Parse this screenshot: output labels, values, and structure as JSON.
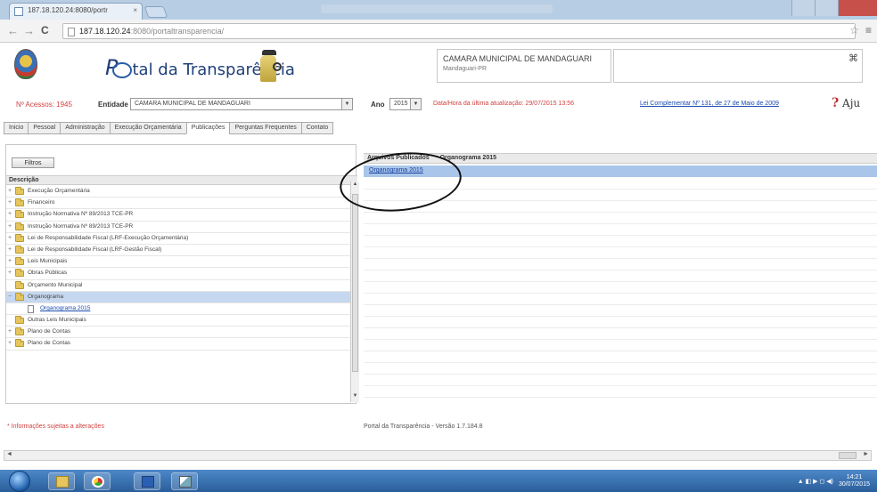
{
  "browser": {
    "tab_title": "187.18.120.24:8080/portr",
    "tab_close": "×",
    "url_host": "187.18.120.24",
    "url_path": ":8080/portaltransparencia/",
    "back": "←",
    "forward": "→",
    "reload": "C",
    "star": "☆",
    "menu": "≡"
  },
  "header": {
    "title_p": "P",
    "title_rest": "tal da Transparência",
    "org_name": "CAMARA MUNICIPAL DE MANDAGUARI",
    "org_city": "Mandaguari-PR",
    "pin": "⌘"
  },
  "filters": {
    "accesses": "Nº Acessos: 1945",
    "entity_label": "Entidade",
    "entity_value": "CAMARA MUNICIPAL DE MANDAGUARI",
    "year_label": "Ano",
    "year_value": "2015",
    "last_update": "Data/Hora da última atualização: 29/07/2015 13:56",
    "law_link": "Lei Complementar Nº 131, de 27 de Maio de 2009",
    "help_label": "Aju",
    "dropdown_glyph": "▼"
  },
  "menu_tabs": [
    {
      "label": "Inicio",
      "active": false
    },
    {
      "label": "Pessoal",
      "active": false
    },
    {
      "label": "Administração",
      "active": false
    },
    {
      "label": "Execução Orçamentária",
      "active": false
    },
    {
      "label": "Publicações",
      "active": true
    },
    {
      "label": "Perguntas Frequentes",
      "active": false
    },
    {
      "label": "Contato",
      "active": false
    }
  ],
  "left_panel": {
    "filter_button": "Filtros",
    "column_header": "Descrição",
    "tree": [
      {
        "label": "Execução Orçamentária",
        "expander": "+",
        "icon": "folder-icon",
        "level": 0,
        "selected": false
      },
      {
        "label": "Financeiro",
        "expander": "+",
        "icon": "folder-icon",
        "level": 0,
        "selected": false
      },
      {
        "label": "Instrução Normativa Nº 89/2013 TCE-PR",
        "expander": "+",
        "icon": "folder-icon",
        "level": 0,
        "selected": false
      },
      {
        "label": "Instrução Normativa Nº 89/2013 TCE-PR",
        "expander": "+",
        "icon": "folder-icon",
        "level": 0,
        "selected": false
      },
      {
        "label": "Lei de Responsabilidade Fiscal (LRF-Execução Orçamentária)",
        "expander": "+",
        "icon": "folder-icon",
        "level": 0,
        "selected": false
      },
      {
        "label": "Lei de Responsabilidade Fiscal (LRF-Gestão Fiscal)",
        "expander": "+",
        "icon": "folder-icon",
        "level": 0,
        "selected": false
      },
      {
        "label": "Leis Municipais",
        "expander": "+",
        "icon": "folder-icon",
        "level": 0,
        "selected": false
      },
      {
        "label": "Obras Públicas",
        "expander": "+",
        "icon": "folder-icon",
        "level": 0,
        "selected": false
      },
      {
        "label": "Orçamento Municipal",
        "expander": "",
        "icon": "folder-icon",
        "level": 0,
        "selected": false
      },
      {
        "label": "Organograma",
        "expander": "−",
        "icon": "folder-icon",
        "level": 0,
        "selected": true
      },
      {
        "label": "Organograma 2015",
        "expander": "",
        "icon": "document-icon",
        "level": 1,
        "selected": false
      },
      {
        "label": "Outras Leis Municipais",
        "expander": "",
        "icon": "folder-icon",
        "level": 0,
        "selected": false
      },
      {
        "label": "Plano de Contas",
        "expander": "+",
        "icon": "folder-icon",
        "level": 0,
        "selected": false
      },
      {
        "label": "Plano de Contas",
        "expander": "+",
        "icon": "folder-icon",
        "level": 0,
        "selected": false
      }
    ],
    "scroll_up": "▲",
    "scroll_down": "▼"
  },
  "right_panel": {
    "col1": "Arquivos Publicados",
    "col2": "Organograma 2015",
    "file_link": "Organograma 2015"
  },
  "footer": {
    "notice": "* Informações sujeitas a alterações",
    "version": "Portal da Transparência - Versão 1.7.184.8",
    "scroll_left": "◄",
    "scroll_right": "►"
  },
  "taskbar": {
    "time": "14:21",
    "date": "30/07/2015",
    "tray_icons": "▲ ◧ ▶ ◻ ◀)"
  }
}
